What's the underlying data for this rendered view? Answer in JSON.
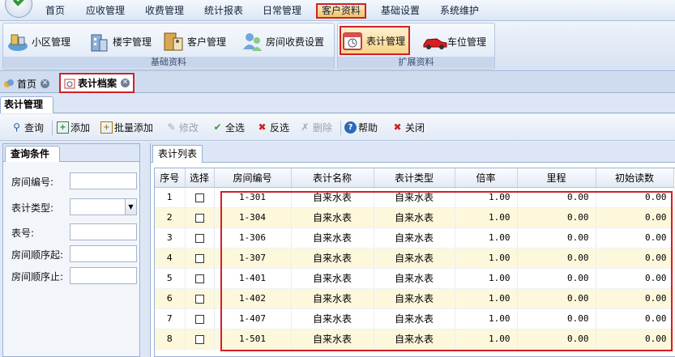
{
  "menu": {
    "items": [
      "首页",
      "应收管理",
      "收费管理",
      "统计报表",
      "日常管理",
      "客户资料",
      "基础设置",
      "系统维护"
    ],
    "active": "客户资料"
  },
  "ribbon": {
    "groups": [
      {
        "label": "基础资料",
        "buttons": [
          {
            "label": "小区管理",
            "icon": "community-icon"
          },
          {
            "label": "楼宇管理",
            "icon": "building-icon"
          },
          {
            "label": "客户管理",
            "icon": "customer-icon"
          },
          {
            "label": "房间收费设置",
            "icon": "room-fee-icon"
          }
        ]
      },
      {
        "label": "扩展资料",
        "buttons": [
          {
            "label": "表计管理",
            "icon": "meter-icon"
          },
          {
            "label": "车位管理",
            "icon": "car-icon"
          }
        ]
      }
    ]
  },
  "doc_tabs": [
    {
      "label": "首页",
      "icon": "home-icon"
    },
    {
      "label": "表计档案",
      "icon": "meter-icon"
    }
  ],
  "panel_title": "表计管理",
  "toolbar": {
    "buttons": [
      {
        "label": "查询",
        "icon": "search-icon",
        "enabled": true
      },
      {
        "label": "添加",
        "icon": "add-icon",
        "enabled": true
      },
      {
        "label": "批量添加",
        "icon": "batch-add-icon",
        "enabled": true
      },
      {
        "label": "修改",
        "icon": "edit-icon",
        "enabled": false
      },
      {
        "label": "全选",
        "icon": "check-all-icon",
        "enabled": true
      },
      {
        "label": "反选",
        "icon": "invert-select-icon",
        "enabled": true
      },
      {
        "label": "删除",
        "icon": "delete-icon",
        "enabled": false
      },
      {
        "label": "帮助",
        "icon": "help-icon",
        "enabled": true
      },
      {
        "label": "关闭",
        "icon": "close-icon",
        "enabled": true
      }
    ]
  },
  "query": {
    "title": "查询条件",
    "fields": [
      {
        "label": "房间编号:",
        "value": ""
      },
      {
        "label": "表计类型:",
        "value": ""
      },
      {
        "label": "表号:",
        "value": ""
      },
      {
        "label": "房间顺序起:",
        "value": ""
      },
      {
        "label": "房间顺序止:",
        "value": ""
      }
    ]
  },
  "list": {
    "tab": "表计列表",
    "columns": [
      "序号",
      "选择",
      "房间编号",
      "表计名称",
      "表计类型",
      "倍率",
      "里程",
      "初始读数"
    ],
    "rows": [
      {
        "no": "1",
        "room": "1-301",
        "name": "自来水表",
        "type": "自来水表",
        "rate": "1.00",
        "mileage": "0.00",
        "initial": "0.00"
      },
      {
        "no": "2",
        "room": "1-304",
        "name": "自来水表",
        "type": "自来水表",
        "rate": "1.00",
        "mileage": "0.00",
        "initial": "0.00"
      },
      {
        "no": "3",
        "room": "1-306",
        "name": "自来水表",
        "type": "自来水表",
        "rate": "1.00",
        "mileage": "0.00",
        "initial": "0.00"
      },
      {
        "no": "4",
        "room": "1-307",
        "name": "自来水表",
        "type": "自来水表",
        "rate": "1.00",
        "mileage": "0.00",
        "initial": "0.00"
      },
      {
        "no": "5",
        "room": "1-401",
        "name": "自来水表",
        "type": "自来水表",
        "rate": "1.00",
        "mileage": "0.00",
        "initial": "0.00"
      },
      {
        "no": "6",
        "room": "1-402",
        "name": "自来水表",
        "type": "自来水表",
        "rate": "1.00",
        "mileage": "0.00",
        "initial": "0.00"
      },
      {
        "no": "7",
        "room": "1-407",
        "name": "自来水表",
        "type": "自来水表",
        "rate": "1.00",
        "mileage": "0.00",
        "initial": "0.00"
      },
      {
        "no": "8",
        "room": "1-501",
        "name": "自来水表",
        "type": "自来水表",
        "rate": "1.00",
        "mileage": "0.00",
        "initial": "0.00"
      }
    ]
  },
  "colors": {
    "highlight": "#d0202a",
    "alt_row": "#fdf8dc",
    "accent_bg": "#dce6f4"
  }
}
